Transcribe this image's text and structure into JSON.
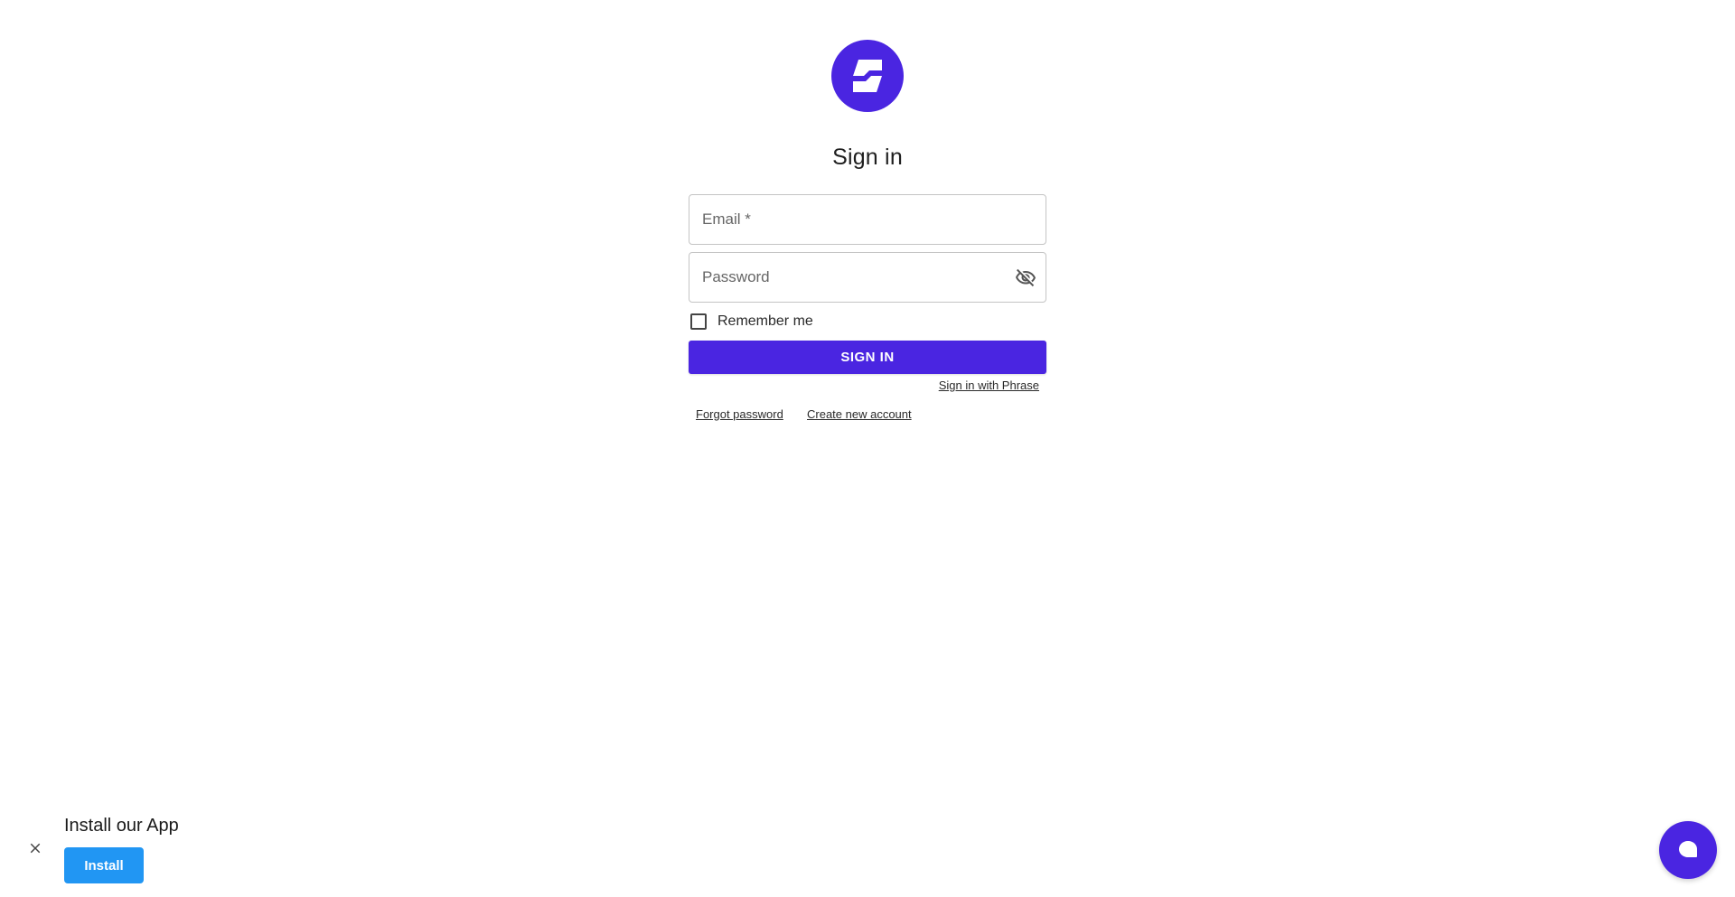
{
  "logo": {
    "icon": "brand-logo",
    "color": "#4a25e1"
  },
  "signin": {
    "title": "Sign in",
    "email_placeholder": "Email *",
    "password_placeholder": "Password",
    "remember_label": "Remember me",
    "submit_label": "SIGN IN",
    "phrase_link": "Sign in with Phrase",
    "forgot_link": "Forgot password",
    "create_link": "Create new account"
  },
  "install": {
    "title": "Install our App",
    "button_label": "Install",
    "button_color": "#2196f3"
  },
  "colors": {
    "accent": "#4a25e1"
  },
  "icons": {
    "password_toggle": "eye-off-icon",
    "close": "close-icon",
    "chat": "chat-bubble-icon"
  }
}
